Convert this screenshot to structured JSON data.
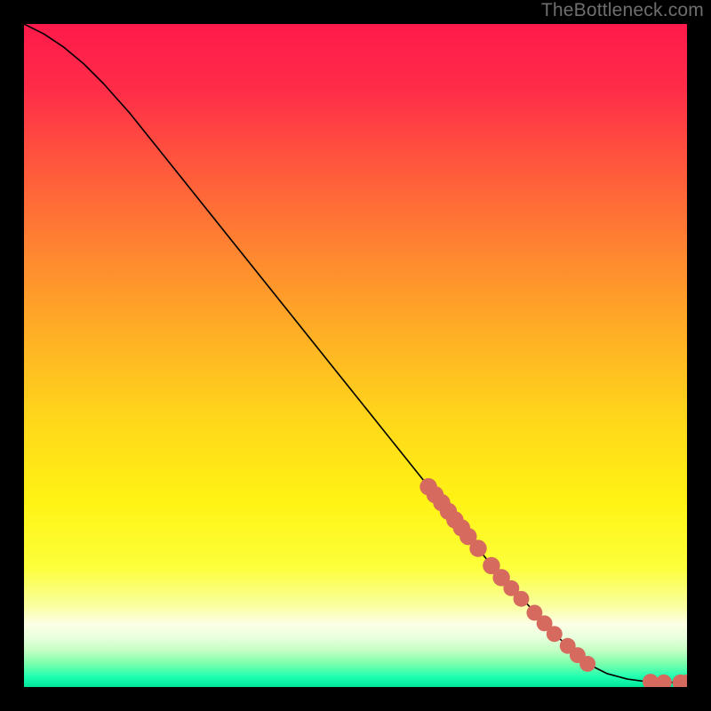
{
  "attribution": "TheBottleneck.com",
  "chart_data": {
    "type": "line",
    "title": "",
    "xlabel": "",
    "ylabel": "",
    "xlim": [
      0,
      100
    ],
    "ylim": [
      0,
      100
    ],
    "curve": [
      {
        "x": 0,
        "y": 100
      },
      {
        "x": 3,
        "y": 98.5
      },
      {
        "x": 6,
        "y": 96.5
      },
      {
        "x": 9,
        "y": 94
      },
      {
        "x": 12,
        "y": 91
      },
      {
        "x": 16,
        "y": 86.5
      },
      {
        "x": 22,
        "y": 79
      },
      {
        "x": 30,
        "y": 69
      },
      {
        "x": 40,
        "y": 56.5
      },
      {
        "x": 50,
        "y": 44
      },
      {
        "x": 60,
        "y": 31.5
      },
      {
        "x": 70,
        "y": 19
      },
      {
        "x": 80,
        "y": 8
      },
      {
        "x": 85,
        "y": 3.5
      },
      {
        "x": 88,
        "y": 2
      },
      {
        "x": 91,
        "y": 1.2
      },
      {
        "x": 94,
        "y": 0.8
      },
      {
        "x": 97,
        "y": 0.7
      },
      {
        "x": 100,
        "y": 0.7
      }
    ],
    "markers": [
      {
        "x": 61,
        "y": 30.2,
        "r": 1.3
      },
      {
        "x": 62,
        "y": 29,
        "r": 1.3
      },
      {
        "x": 63,
        "y": 27.8,
        "r": 1.3
      },
      {
        "x": 64,
        "y": 26.5,
        "r": 1.3
      },
      {
        "x": 65,
        "y": 25.2,
        "r": 1.3
      },
      {
        "x": 66,
        "y": 24,
        "r": 1.3
      },
      {
        "x": 67,
        "y": 22.7,
        "r": 1.3
      },
      {
        "x": 68.5,
        "y": 20.9,
        "r": 1.3
      },
      {
        "x": 70.5,
        "y": 18.3,
        "r": 1.3
      },
      {
        "x": 72,
        "y": 16.5,
        "r": 1.3
      },
      {
        "x": 73.5,
        "y": 14.9,
        "r": 1.2
      },
      {
        "x": 75,
        "y": 13.3,
        "r": 1.2
      },
      {
        "x": 77,
        "y": 11.2,
        "r": 1.2
      },
      {
        "x": 78.5,
        "y": 9.6,
        "r": 1.2
      },
      {
        "x": 80,
        "y": 8,
        "r": 1.2
      },
      {
        "x": 82,
        "y": 6.2,
        "r": 1.2
      },
      {
        "x": 83.5,
        "y": 4.8,
        "r": 1.2
      },
      {
        "x": 85,
        "y": 3.5,
        "r": 1.2
      },
      {
        "x": 94.5,
        "y": 0.8,
        "r": 1.2
      },
      {
        "x": 96.5,
        "y": 0.7,
        "r": 1.2
      },
      {
        "x": 99,
        "y": 0.7,
        "r": 1.2
      },
      {
        "x": 100,
        "y": 0.7,
        "r": 1.2
      }
    ],
    "marker_color": "#d66a5e",
    "background_gradient": {
      "stops": [
        {
          "offset": 0.0,
          "color": "#ff1a4b"
        },
        {
          "offset": 0.1,
          "color": "#ff2d48"
        },
        {
          "offset": 0.22,
          "color": "#ff5a3c"
        },
        {
          "offset": 0.35,
          "color": "#ff8830"
        },
        {
          "offset": 0.48,
          "color": "#ffb324"
        },
        {
          "offset": 0.6,
          "color": "#ffd81a"
        },
        {
          "offset": 0.72,
          "color": "#fff314"
        },
        {
          "offset": 0.82,
          "color": "#fcff3a"
        },
        {
          "offset": 0.88,
          "color": "#faffa6"
        },
        {
          "offset": 0.905,
          "color": "#fdffe6"
        },
        {
          "offset": 0.925,
          "color": "#e8ffdd"
        },
        {
          "offset": 0.945,
          "color": "#c4ffc4"
        },
        {
          "offset": 0.965,
          "color": "#7affab"
        },
        {
          "offset": 0.985,
          "color": "#1dffb0"
        },
        {
          "offset": 1.0,
          "color": "#00e59a"
        }
      ]
    }
  }
}
